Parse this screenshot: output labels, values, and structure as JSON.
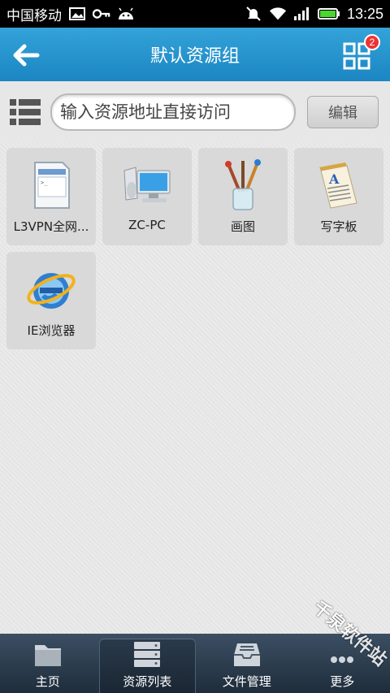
{
  "status_bar": {
    "carrier": "中国移动",
    "time": "13:25"
  },
  "header": {
    "title": "默认资源组",
    "badge_count": "2"
  },
  "search": {
    "placeholder": "输入资源地址直接访问",
    "edit_label": "编辑"
  },
  "resources": [
    {
      "label": "L3VPN全网...",
      "icon": "window-icon"
    },
    {
      "label": "ZC-PC",
      "icon": "computer-icon"
    },
    {
      "label": "画图",
      "icon": "paint-brushes-icon"
    },
    {
      "label": "写字板",
      "icon": "wordpad-icon"
    },
    {
      "label": "IE浏览器",
      "icon": "ie-icon"
    }
  ],
  "nav": [
    {
      "label": "主页",
      "icon": "folder-icon"
    },
    {
      "label": "资源列表",
      "icon": "server-icon"
    },
    {
      "label": "文件管理",
      "icon": "file-tray-icon"
    },
    {
      "label": "更多",
      "icon": "more-icon"
    }
  ],
  "watermark": "千泉软件站",
  "colors": {
    "header": "#1b86c2",
    "nav": "#1f2d3b",
    "badge": "#e33333"
  }
}
